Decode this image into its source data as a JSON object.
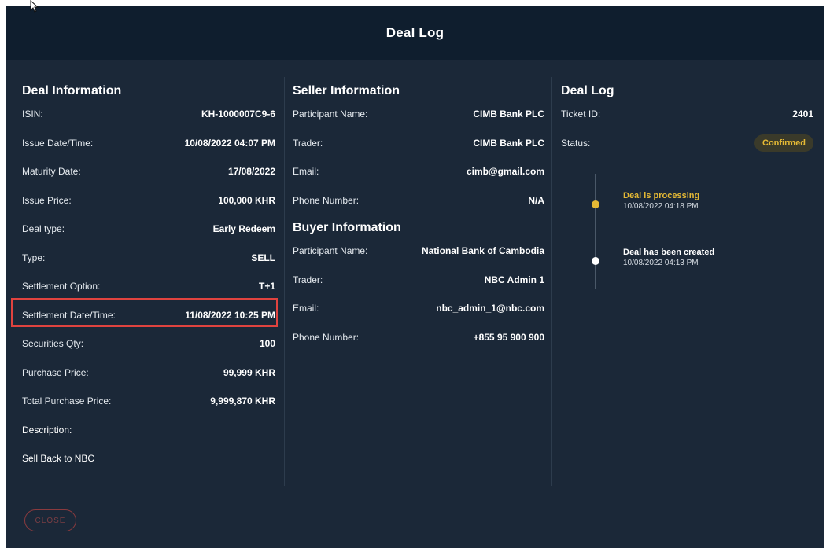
{
  "dialog": {
    "title": "Deal Log",
    "close_label": "CLOSE"
  },
  "deal_information": {
    "title": "Deal Information",
    "rows": [
      {
        "label": "ISIN:",
        "value": "KH-1000007C9-6"
      },
      {
        "label": "Issue Date/Time:",
        "value": "10/08/2022 04:07 PM"
      },
      {
        "label": "Maturity Date:",
        "value": "17/08/2022"
      },
      {
        "label": "Issue Price:",
        "value": "100,000 KHR"
      },
      {
        "label": "Deal type:",
        "value": "Early Redeem"
      },
      {
        "label": "Type:",
        "value": "SELL"
      },
      {
        "label": "Settlement Option:",
        "value": "T+1"
      },
      {
        "label": "Settlement Date/Time:",
        "value": "11/08/2022 10:25 PM"
      },
      {
        "label": "Securities Qty:",
        "value": "100"
      },
      {
        "label": "Purchase Price:",
        "value": "99,999 KHR"
      },
      {
        "label": "Total Purchase Price:",
        "value": "9,999,870 KHR"
      }
    ],
    "description_label": "Description:",
    "description_value": "Sell Back to NBC"
  },
  "seller_information": {
    "title": "Seller Information",
    "rows": [
      {
        "label": "Participant Name:",
        "value": "CIMB Bank PLC"
      },
      {
        "label": "Trader:",
        "value": "CIMB Bank PLC"
      },
      {
        "label": "Email:",
        "value": "cimb@gmail.com"
      },
      {
        "label": "Phone Number:",
        "value": "N/A"
      }
    ]
  },
  "buyer_information": {
    "title": "Buyer Information",
    "rows": [
      {
        "label": "Participant Name:",
        "value": "National Bank of Cambodia"
      },
      {
        "label": "Trader:",
        "value": "NBC Admin 1"
      },
      {
        "label": "Email:",
        "value": "nbc_admin_1@nbc.com"
      },
      {
        "label": "Phone Number:",
        "value": "+855 95 900 900"
      }
    ]
  },
  "deal_log": {
    "title": "Deal Log",
    "ticket_label": "Ticket ID:",
    "ticket_value": "2401",
    "status_label": "Status:",
    "status_value": "Confirmed",
    "status_color": "#e5b935",
    "timeline": [
      {
        "title": "Deal is processing",
        "time": "10/08/2022 04:18 PM",
        "color": "#e5b935"
      },
      {
        "title": "Deal has been created",
        "time": "10/08/2022 04:13 PM",
        "color": "#ffffff"
      }
    ]
  }
}
